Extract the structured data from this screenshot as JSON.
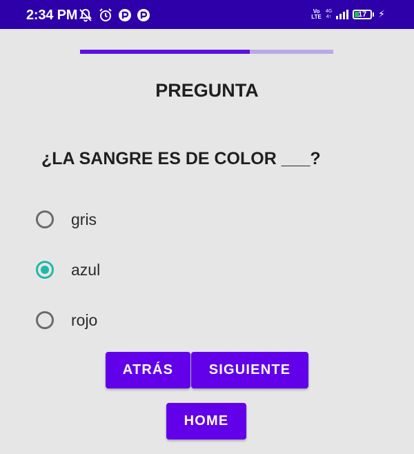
{
  "status_bar": {
    "time": "2:34 PM",
    "volte_top": "Vo",
    "volte_bottom": "LTE",
    "network_top": "4G",
    "network_bottom": "4↑",
    "battery_level": "17",
    "icons": [
      "notifications-off-icon",
      "alarm-icon",
      "app-notification-icon",
      "app-notification-icon",
      "signal-icon",
      "battery-icon",
      "charging-icon"
    ]
  },
  "quiz": {
    "progress_fraction": 0.67,
    "title": "PREGUNTA",
    "question": "¿LA SANGRE ES DE COLOR ___?",
    "options": [
      {
        "label": "gris",
        "selected": false
      },
      {
        "label": "azul",
        "selected": true
      },
      {
        "label": "rojo",
        "selected": false
      }
    ]
  },
  "buttons": {
    "back": "ATRÁS",
    "next": "SIGUIENTE",
    "home": "HOME"
  },
  "colors": {
    "status_bar": "#2e00a9",
    "primary": "#6200ea",
    "radio_checked": "#20b8a8",
    "background": "#e6e6e6"
  }
}
